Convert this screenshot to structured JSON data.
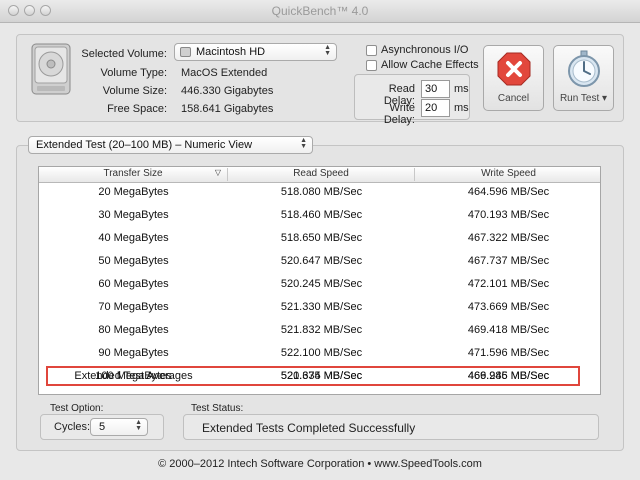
{
  "window": {
    "title": "QuickBench™ 4.0"
  },
  "volume": {
    "selected_label": "Selected Volume:",
    "selected_value": "Macintosh HD",
    "type_label": "Volume Type:",
    "type_value": "MacOS Extended",
    "size_label": "Volume Size:",
    "size_value": "446.330 Gigabytes",
    "free_label": "Free Space:",
    "free_value": "158.641 Gigabytes"
  },
  "options": {
    "async_label": "Asynchronous I/O",
    "cache_label": "Allow Cache Effects",
    "read_delay_label": "Read Delay:",
    "read_delay_value": "30",
    "write_delay_label": "Write Delay:",
    "write_delay_value": "20",
    "ms_unit": "ms"
  },
  "buttons": {
    "cancel": "Cancel",
    "run_test": "Run Test"
  },
  "view_selector": {
    "value": "Extended Test (20–100 MB) – Numeric View"
  },
  "table": {
    "columns": [
      "Transfer Size",
      "Read Speed",
      "Write Speed"
    ],
    "rows": [
      {
        "size": "20 MegaBytes",
        "read": "518.080 MB/Sec",
        "write": "464.596 MB/Sec"
      },
      {
        "size": "30 MegaBytes",
        "read": "518.460 MB/Sec",
        "write": "470.193 MB/Sec"
      },
      {
        "size": "40 MegaBytes",
        "read": "518.650 MB/Sec",
        "write": "467.322 MB/Sec"
      },
      {
        "size": "50 MegaBytes",
        "read": "520.647 MB/Sec",
        "write": "467.737 MB/Sec"
      },
      {
        "size": "60 MegaBytes",
        "read": "520.245 MB/Sec",
        "write": "472.101 MB/Sec"
      },
      {
        "size": "70 MegaBytes",
        "read": "521.330 MB/Sec",
        "write": "473.669 MB/Sec"
      },
      {
        "size": "80 MegaBytes",
        "read": "521.832 MB/Sec",
        "write": "469.418 MB/Sec"
      },
      {
        "size": "90 MegaBytes",
        "read": "522.100 MB/Sec",
        "write": "471.596 MB/Sec"
      },
      {
        "size": "100 MegaBytes",
        "read": "521.674 MB/Sec",
        "write": "466.945 MB/Sec"
      }
    ],
    "averages": {
      "size": "Extended Test Averages",
      "read": "520.335 MB/Sec",
      "write": "469.286 MB/Sec"
    },
    "highlight_color": "#e0463c"
  },
  "test_option": {
    "label": "Test Option:",
    "cycles_label": "Cycles:",
    "cycles_value": "5"
  },
  "test_status": {
    "label": "Test Status:",
    "value": "Extended Tests Completed Successfully"
  },
  "footer": {
    "copyright": "© 2000–2012 Intech Software Corporation • www.SpeedTools.com"
  }
}
